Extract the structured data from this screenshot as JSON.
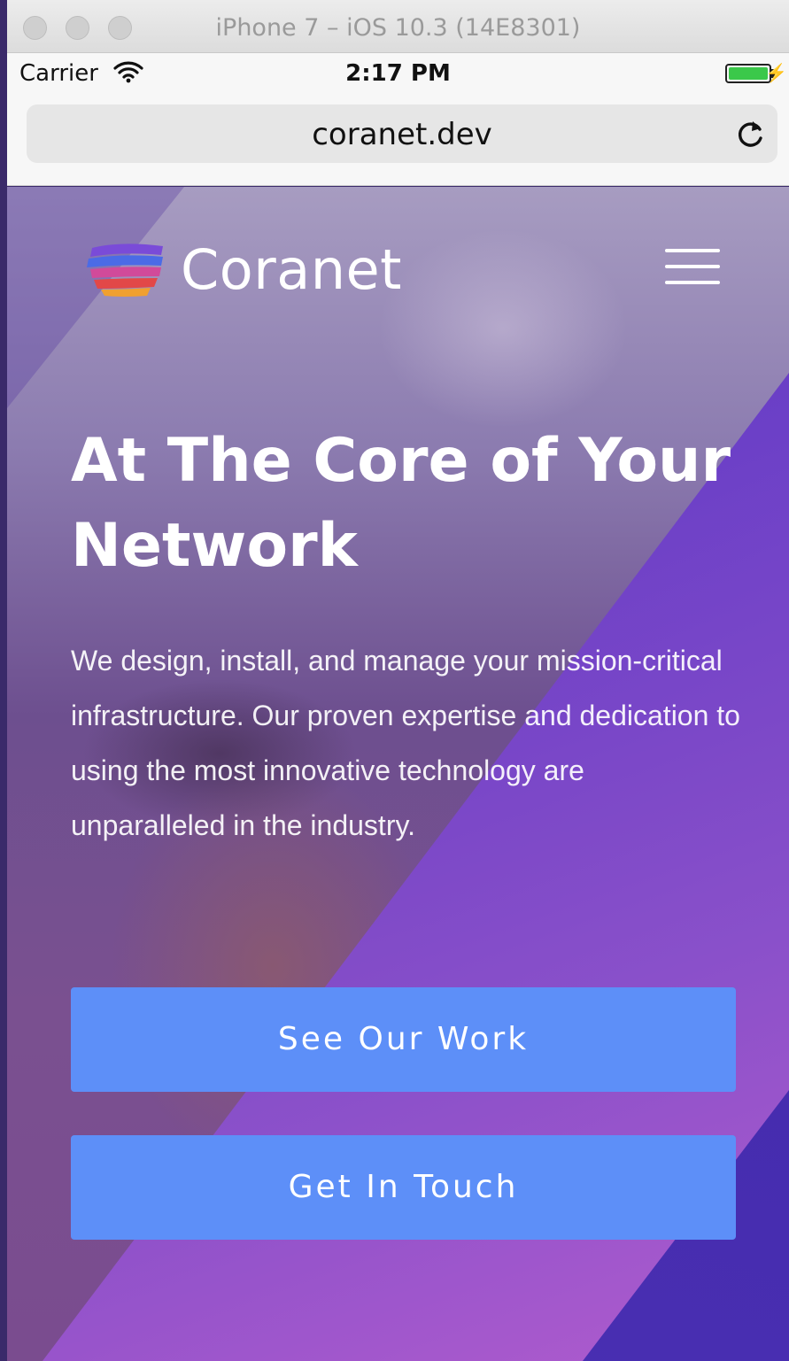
{
  "window": {
    "title": "iPhone 7 – iOS 10.3 (14E8301)"
  },
  "status_bar": {
    "carrier": "Carrier",
    "time": "2:17 PM"
  },
  "browser": {
    "url": "coranet.dev"
  },
  "site": {
    "brand": "Coranet",
    "headline": "At The Core of Your Network",
    "lede": "We design, install, and manage your mission-critical infrastructure. Our proven expertise and dedication to using the most innovative technology are unparalleled in the industry.",
    "buttons": {
      "primary": "See Our Work",
      "secondary": "Get In Touch"
    }
  },
  "colors": {
    "button": "#5d8ff8",
    "battery": "#3bc84a",
    "hero_purple": "#5a2fb5"
  },
  "icons": [
    "wifi-icon",
    "battery-icon",
    "charging-bolt-icon",
    "reload-icon",
    "coranet-logo-mark",
    "hamburger-menu-icon"
  ]
}
